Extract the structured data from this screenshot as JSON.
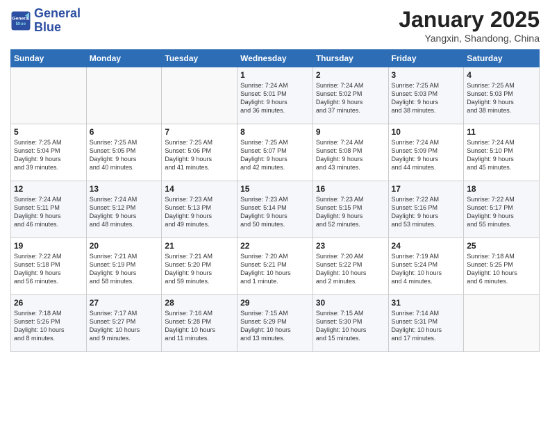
{
  "header": {
    "logo_line1": "General",
    "logo_line2": "Blue",
    "month": "January 2025",
    "location": "Yangxin, Shandong, China"
  },
  "weekdays": [
    "Sunday",
    "Monday",
    "Tuesday",
    "Wednesday",
    "Thursday",
    "Friday",
    "Saturday"
  ],
  "weeks": [
    [
      {
        "day": "",
        "content": ""
      },
      {
        "day": "",
        "content": ""
      },
      {
        "day": "",
        "content": ""
      },
      {
        "day": "1",
        "content": "Sunrise: 7:24 AM\nSunset: 5:01 PM\nDaylight: 9 hours\nand 36 minutes."
      },
      {
        "day": "2",
        "content": "Sunrise: 7:24 AM\nSunset: 5:02 PM\nDaylight: 9 hours\nand 37 minutes."
      },
      {
        "day": "3",
        "content": "Sunrise: 7:25 AM\nSunset: 5:03 PM\nDaylight: 9 hours\nand 38 minutes."
      },
      {
        "day": "4",
        "content": "Sunrise: 7:25 AM\nSunset: 5:03 PM\nDaylight: 9 hours\nand 38 minutes."
      }
    ],
    [
      {
        "day": "5",
        "content": "Sunrise: 7:25 AM\nSunset: 5:04 PM\nDaylight: 9 hours\nand 39 minutes."
      },
      {
        "day": "6",
        "content": "Sunrise: 7:25 AM\nSunset: 5:05 PM\nDaylight: 9 hours\nand 40 minutes."
      },
      {
        "day": "7",
        "content": "Sunrise: 7:25 AM\nSunset: 5:06 PM\nDaylight: 9 hours\nand 41 minutes."
      },
      {
        "day": "8",
        "content": "Sunrise: 7:25 AM\nSunset: 5:07 PM\nDaylight: 9 hours\nand 42 minutes."
      },
      {
        "day": "9",
        "content": "Sunrise: 7:24 AM\nSunset: 5:08 PM\nDaylight: 9 hours\nand 43 minutes."
      },
      {
        "day": "10",
        "content": "Sunrise: 7:24 AM\nSunset: 5:09 PM\nDaylight: 9 hours\nand 44 minutes."
      },
      {
        "day": "11",
        "content": "Sunrise: 7:24 AM\nSunset: 5:10 PM\nDaylight: 9 hours\nand 45 minutes."
      }
    ],
    [
      {
        "day": "12",
        "content": "Sunrise: 7:24 AM\nSunset: 5:11 PM\nDaylight: 9 hours\nand 46 minutes."
      },
      {
        "day": "13",
        "content": "Sunrise: 7:24 AM\nSunset: 5:12 PM\nDaylight: 9 hours\nand 48 minutes."
      },
      {
        "day": "14",
        "content": "Sunrise: 7:23 AM\nSunset: 5:13 PM\nDaylight: 9 hours\nand 49 minutes."
      },
      {
        "day": "15",
        "content": "Sunrise: 7:23 AM\nSunset: 5:14 PM\nDaylight: 9 hours\nand 50 minutes."
      },
      {
        "day": "16",
        "content": "Sunrise: 7:23 AM\nSunset: 5:15 PM\nDaylight: 9 hours\nand 52 minutes."
      },
      {
        "day": "17",
        "content": "Sunrise: 7:22 AM\nSunset: 5:16 PM\nDaylight: 9 hours\nand 53 minutes."
      },
      {
        "day": "18",
        "content": "Sunrise: 7:22 AM\nSunset: 5:17 PM\nDaylight: 9 hours\nand 55 minutes."
      }
    ],
    [
      {
        "day": "19",
        "content": "Sunrise: 7:22 AM\nSunset: 5:18 PM\nDaylight: 9 hours\nand 56 minutes."
      },
      {
        "day": "20",
        "content": "Sunrise: 7:21 AM\nSunset: 5:19 PM\nDaylight: 9 hours\nand 58 minutes."
      },
      {
        "day": "21",
        "content": "Sunrise: 7:21 AM\nSunset: 5:20 PM\nDaylight: 9 hours\nand 59 minutes."
      },
      {
        "day": "22",
        "content": "Sunrise: 7:20 AM\nSunset: 5:21 PM\nDaylight: 10 hours\nand 1 minute."
      },
      {
        "day": "23",
        "content": "Sunrise: 7:20 AM\nSunset: 5:22 PM\nDaylight: 10 hours\nand 2 minutes."
      },
      {
        "day": "24",
        "content": "Sunrise: 7:19 AM\nSunset: 5:24 PM\nDaylight: 10 hours\nand 4 minutes."
      },
      {
        "day": "25",
        "content": "Sunrise: 7:18 AM\nSunset: 5:25 PM\nDaylight: 10 hours\nand 6 minutes."
      }
    ],
    [
      {
        "day": "26",
        "content": "Sunrise: 7:18 AM\nSunset: 5:26 PM\nDaylight: 10 hours\nand 8 minutes."
      },
      {
        "day": "27",
        "content": "Sunrise: 7:17 AM\nSunset: 5:27 PM\nDaylight: 10 hours\nand 9 minutes."
      },
      {
        "day": "28",
        "content": "Sunrise: 7:16 AM\nSunset: 5:28 PM\nDaylight: 10 hours\nand 11 minutes."
      },
      {
        "day": "29",
        "content": "Sunrise: 7:15 AM\nSunset: 5:29 PM\nDaylight: 10 hours\nand 13 minutes."
      },
      {
        "day": "30",
        "content": "Sunrise: 7:15 AM\nSunset: 5:30 PM\nDaylight: 10 hours\nand 15 minutes."
      },
      {
        "day": "31",
        "content": "Sunrise: 7:14 AM\nSunset: 5:31 PM\nDaylight: 10 hours\nand 17 minutes."
      },
      {
        "day": "",
        "content": ""
      }
    ]
  ]
}
